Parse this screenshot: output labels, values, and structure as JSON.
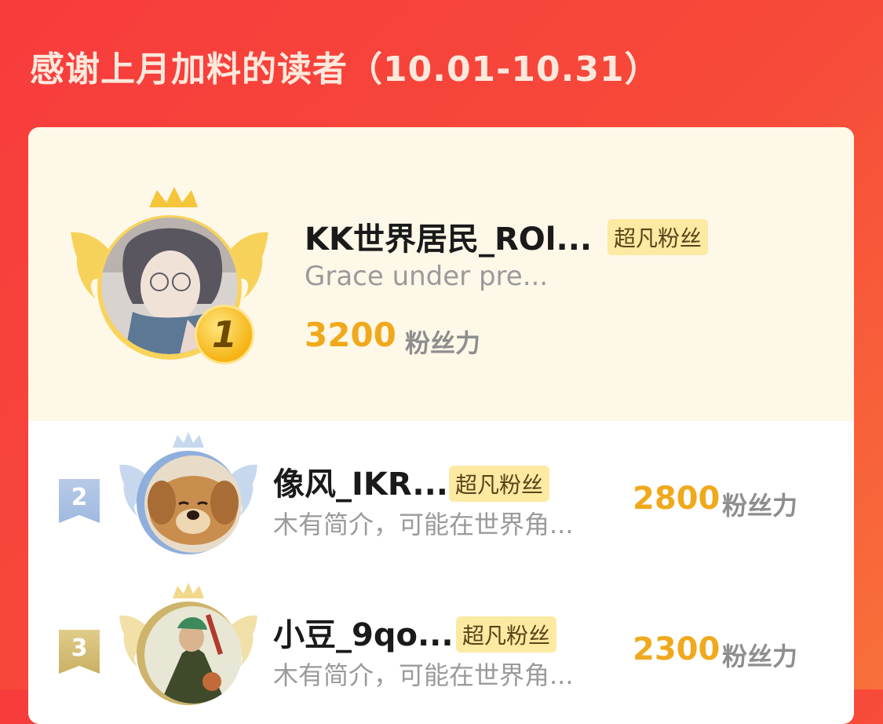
{
  "header": {
    "title": "感谢上月加料的读者（10.01-10.31）"
  },
  "ranking": [
    {
      "rank": "1",
      "name": "KK世界居民_ROl...",
      "badge": "超凡粉丝",
      "description": "Grace under pre...",
      "score": "3200",
      "score_unit": "粉丝力"
    },
    {
      "rank": "2",
      "name": "像风_IKR...",
      "badge": "超凡粉丝",
      "description": "木有简介，可能在世界角...",
      "score": "2800",
      "score_unit": "粉丝力"
    },
    {
      "rank": "3",
      "name": "小豆_9qo...",
      "badge": "超凡粉丝",
      "description": "木有简介，可能在世界角...",
      "score": "2300",
      "score_unit": "粉丝力"
    }
  ],
  "colors": {
    "background": "#f73c3c",
    "score": "#f0a91c",
    "badge_bg": "#fdeaa2",
    "gold": "#f5c53a",
    "silver": "#a9c4e8",
    "bronze": "#d8c078"
  }
}
